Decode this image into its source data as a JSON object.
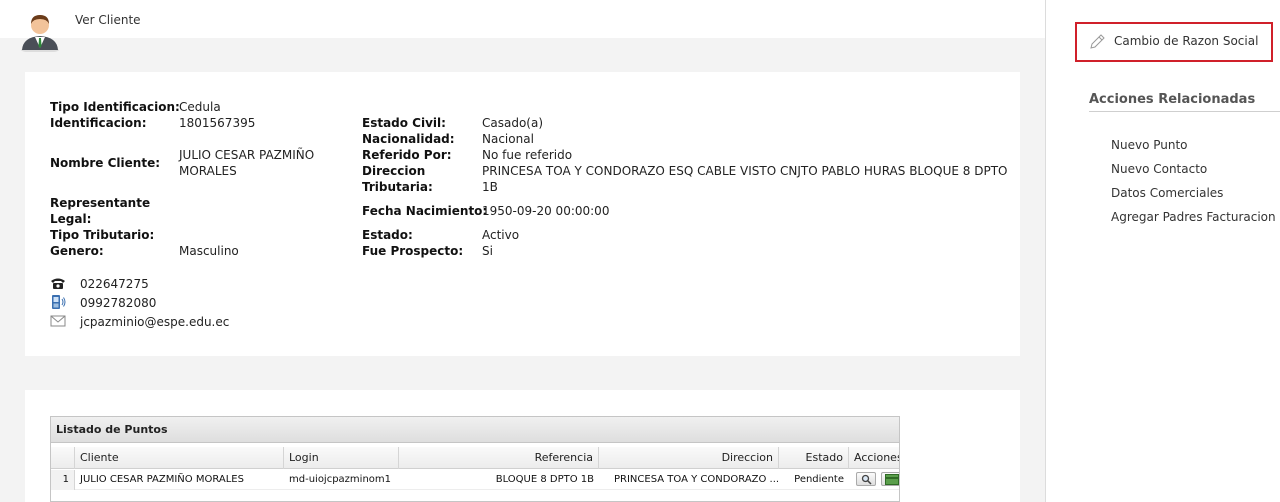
{
  "header": {
    "title": "Ver Cliente"
  },
  "client": {
    "left": {
      "tipo_identificacion_label": "Tipo Identificacion:",
      "tipo_identificacion": "Cedula",
      "identificacion_label": "Identificacion:",
      "identificacion": "1801567395",
      "nombre_label": "Nombre Cliente:",
      "nombre_line1": "JULIO CESAR PAZMIÑO",
      "nombre_line2": "MORALES",
      "representante_label1": "Representante",
      "representante_label2": "Legal:",
      "tipo_tributario_label": "Tipo Tributario:",
      "genero_label": "Genero:",
      "genero": "Masculino"
    },
    "right": {
      "estado_civil_label": "Estado Civil:",
      "estado_civil": "Casado(a)",
      "nacionalidad_label": "Nacionalidad:",
      "nacionalidad": "Nacional",
      "referido_label": "Referido Por:",
      "referido": "No fue referido",
      "direccion_label1": "Direccion",
      "direccion_label2": "Tributaria:",
      "direccion_line1": "PRINCESA TOA Y CONDORAZO ESQ CABLE VISTO CNJTO PABLO HURAS BLOQUE 8 DPTO",
      "direccion_line2": "1B",
      "fecha_label": "Fecha Nacimiento:",
      "fecha": "1950-09-20 00:00:00",
      "estado_label": "Estado:",
      "estado": "Activo",
      "prospecto_label": "Fue Prospecto:",
      "prospecto": "Si"
    },
    "contacts": {
      "phone": "022647275",
      "mobile": "0992782080",
      "email": "jcpazminio@espe.edu.ec"
    }
  },
  "grid": {
    "title": "Listado de Puntos",
    "columns": [
      "Cliente",
      "Login",
      "Referencia",
      "Direccion",
      "Estado",
      "Acciones"
    ],
    "rows": [
      {
        "num": "1",
        "cliente": "JULIO CESAR PAZMIÑO MORALES",
        "login": "md-uiojcpazminom1",
        "referencia": "BLOQUE 8 DPTO 1B",
        "direccion": "PRINCESA TOA Y CONDORAZO ...",
        "estado": "Pendiente"
      }
    ]
  },
  "side": {
    "cambio_button": "Cambio de Razon Social",
    "acciones_title": "Acciones Relacionadas",
    "links": [
      "Nuevo Punto",
      "Nuevo Contacto",
      "Datos Comerciales",
      "Agregar Padres Facturacion"
    ]
  },
  "colors": {
    "highlight_border": "#d0202a",
    "background": "#f3f3f3"
  },
  "icons": [
    "user-avatar-icon",
    "phone-icon",
    "mobile-icon",
    "email-icon",
    "pencil-icon",
    "magnifier-icon",
    "card-icon"
  ]
}
